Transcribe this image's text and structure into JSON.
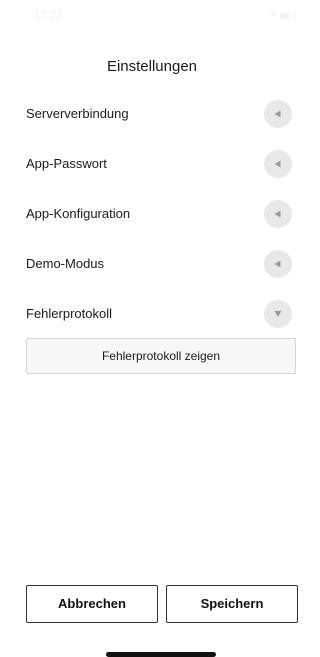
{
  "status_bar": {
    "time": "17:22"
  },
  "title": "Einstellungen",
  "settings": [
    {
      "label": "Serververbindung",
      "icon": "triangle-left-icon",
      "expanded": false
    },
    {
      "label": "App-Passwort",
      "icon": "triangle-left-icon",
      "expanded": false
    },
    {
      "label": "App-Konfiguration",
      "icon": "triangle-left-icon",
      "expanded": false
    },
    {
      "label": "Demo-Modus",
      "icon": "triangle-left-icon",
      "expanded": false
    },
    {
      "label": "Fehlerprotokoll",
      "icon": "triangle-down-icon",
      "expanded": true
    }
  ],
  "error_log": {
    "show_button_label": "Fehlerprotokoll zeigen"
  },
  "footer": {
    "cancel_label": "Abbrechen",
    "save_label": "Speichern"
  },
  "colors": {
    "text": "#1a1a1a",
    "toggle_bg": "#e8e8e8",
    "toggle_icon": "#9a9a9a",
    "border": "#333333"
  }
}
